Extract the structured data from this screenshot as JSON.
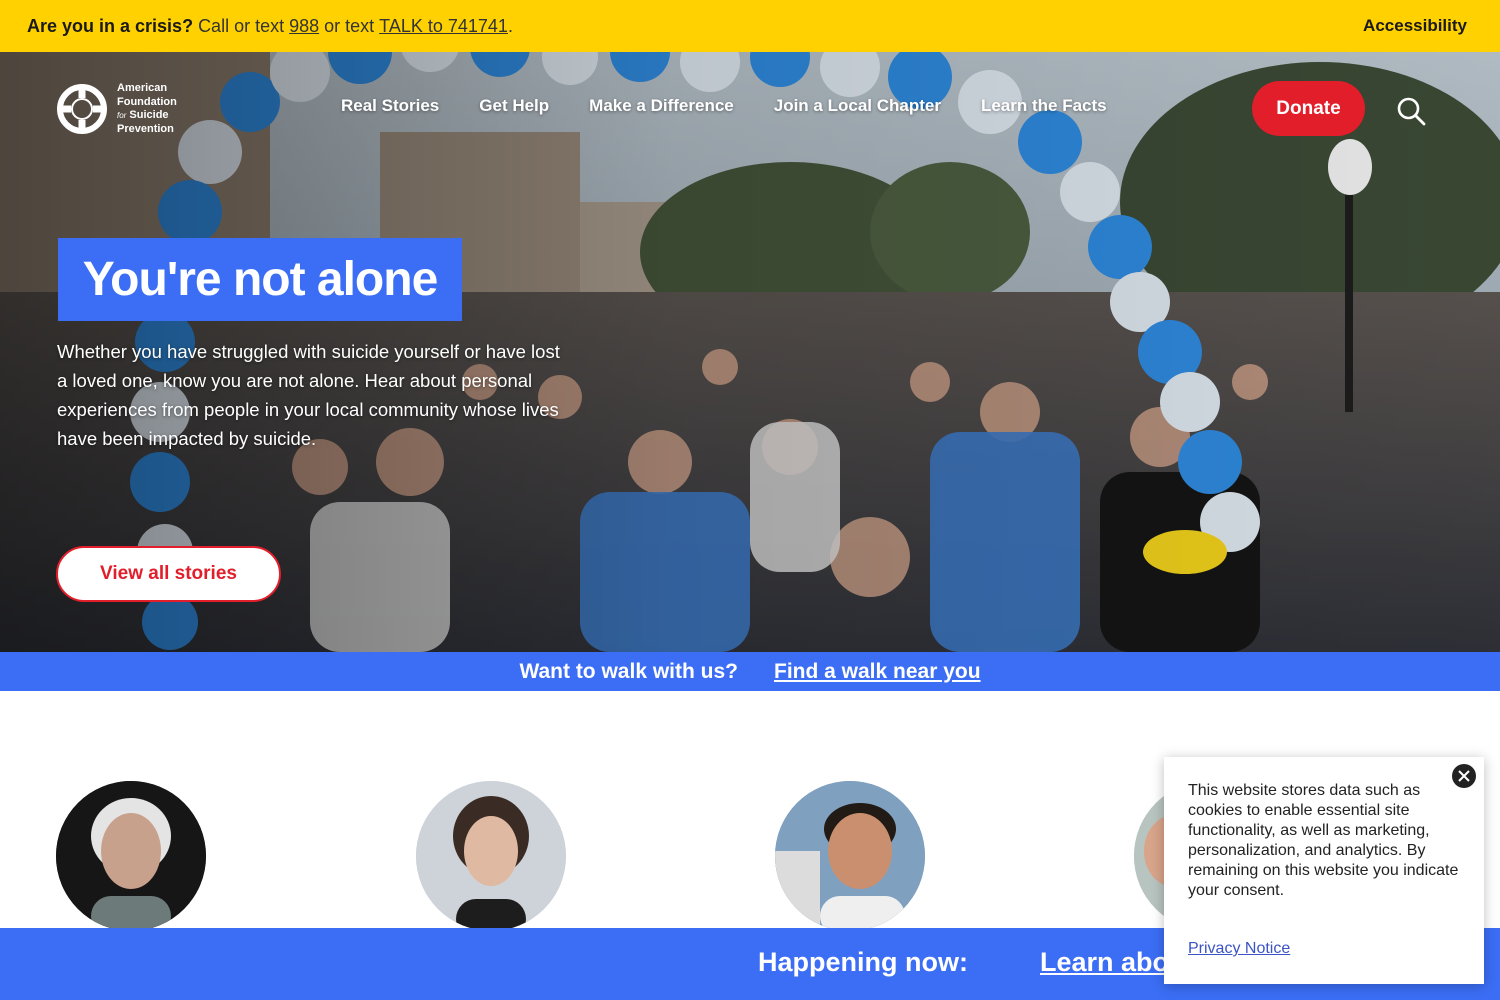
{
  "crisis_bar": {
    "question": "Are you in a crisis?",
    "call_text": "Call or text",
    "call_number": "988",
    "or_text": "or text",
    "text_link": "TALK to 741741",
    "period": ".",
    "accessibility": "Accessibility"
  },
  "logo": {
    "line1": "American",
    "line2": "Foundation",
    "line3_for": "for",
    "line3": "Suicide",
    "line4": "Prevention"
  },
  "nav": {
    "items": [
      "Real Stories",
      "Get Help",
      "Make a Difference",
      "Join a Local Chapter",
      "Learn the Facts"
    ]
  },
  "header": {
    "donate": "Donate",
    "search_icon": "search-icon"
  },
  "hero": {
    "headline": "You're not alone",
    "body": "Whether you have struggled with suicide yourself or have lost a loved one, know you are not alone. Hear about personal experiences from people in your local community whose lives have been impacted by suicide.",
    "button": "View all stories"
  },
  "walk_bar": {
    "prompt": "Want to walk with us?",
    "link": "Find a walk near you"
  },
  "happening_bar": {
    "label": "Happening now:",
    "link": "Learn abo"
  },
  "cookie": {
    "text": "This website stores data such as cookies to enable essential site functionality, as well as marketing, personalization, and analytics. By remaining on this website you indicate your consent.",
    "privacy_link": "Privacy Notice",
    "close_icon": "close-icon"
  },
  "colors": {
    "crisis_yellow": "#ffd100",
    "brand_blue": "#3b6ef5",
    "donate_red": "#e21e2b"
  }
}
